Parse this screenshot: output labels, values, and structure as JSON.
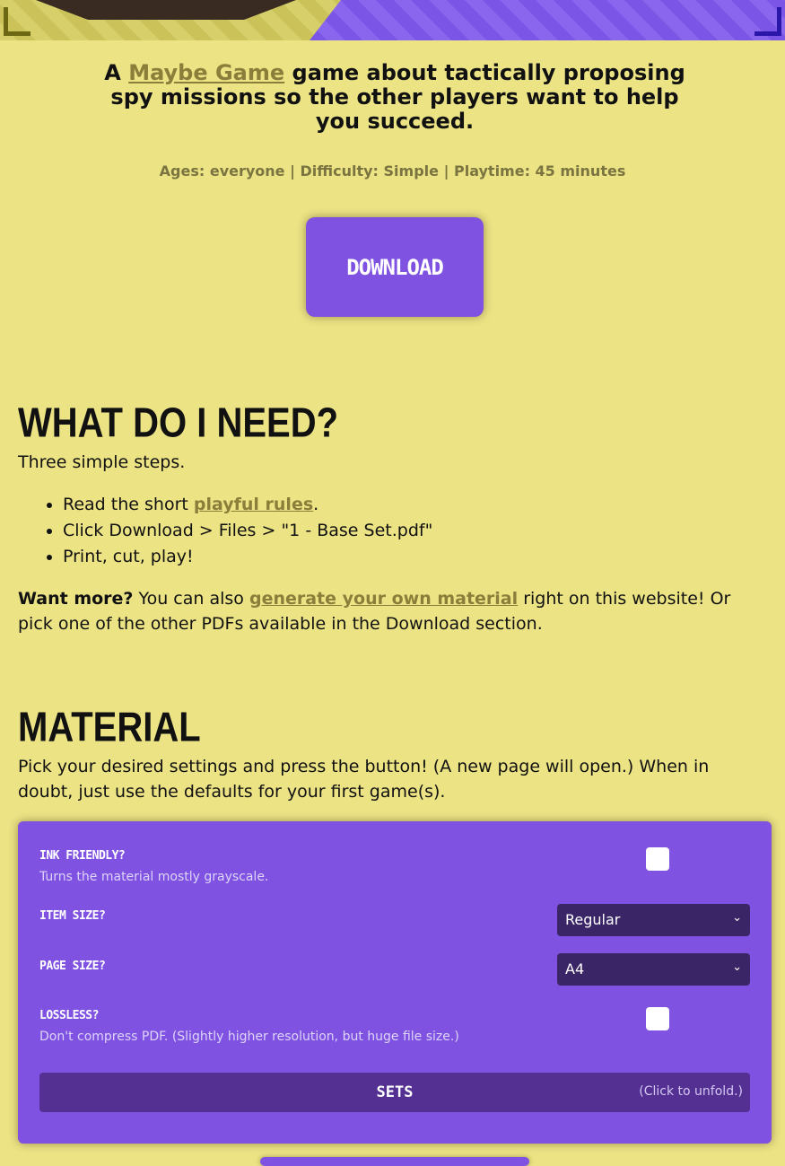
{
  "intro": {
    "tagline_prefix": "A",
    "game_link": "Maybe Game",
    "tagline_suffix": "game about tactically proposing spy missions so the other players want to help you succeed.",
    "meta": "Ages: everyone | Difficulty: Simple | Playtime: 45 minutes",
    "download_label": "DOWNLOAD"
  },
  "need": {
    "heading": "WHAT DO I NEED?",
    "intro": "Three simple steps.",
    "step1_prefix": "Read the short",
    "step1_link": "playful rules",
    "step1_suffix": ".",
    "step2": "Click Download > Files > \"1 - Base Set.pdf\"",
    "step3": "Print, cut, play!",
    "more_bold": "Want more?",
    "more_text1": "You can also",
    "more_link": "generate your own material",
    "more_text2": "right on this website! Or pick one of the other PDFs available in the Download section."
  },
  "material": {
    "heading": "MATERIAL",
    "intro": "Pick your desired settings and press the button! (A new page will open.) When in doubt, just use the defaults for your first game(s).",
    "ink_label": "INK FRIENDLY?",
    "ink_desc": "Turns the material mostly grayscale.",
    "item_size_label": "ITEM SIZE?",
    "item_size_value": "Regular",
    "page_size_label": "PAGE SIZE?",
    "page_size_value": "A4",
    "lossless_label": "LOSSLESS?",
    "lossless_desc": "Don't compress PDF. (Slightly higher resolution, but huge file size.)",
    "sets_label": "SETS",
    "sets_hint": "(Click to unfold.)"
  },
  "colors": {
    "background": "#ece385",
    "accent": "#7f52e2",
    "link": "#8a7e3a"
  }
}
